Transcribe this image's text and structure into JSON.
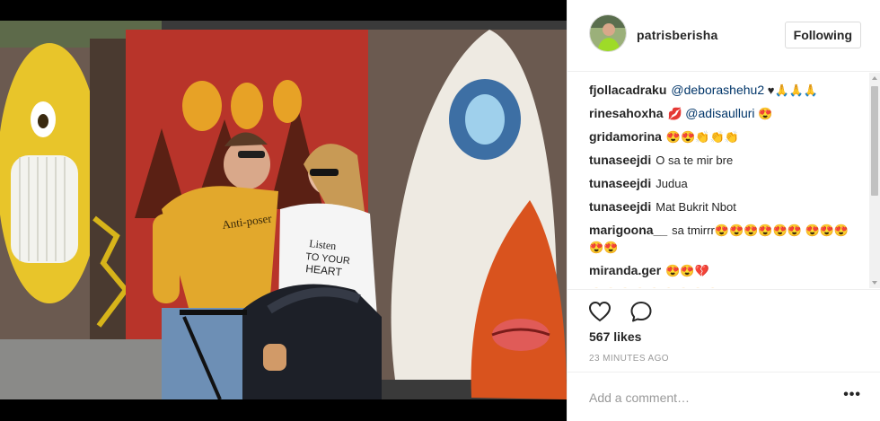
{
  "post": {
    "username": "patrisberisha",
    "follow_label": "Following",
    "photo_text": {
      "shirt_left": "Anti-poser",
      "shirt_right_line1": "Listen",
      "shirt_right_line2": "TO YOUR",
      "shirt_right_line3": "HEART"
    }
  },
  "comments": [
    {
      "user": "fjollacadraku",
      "mention": "@deborashehu2",
      "text": " ♥🙏🙏🙏"
    },
    {
      "user": "rinesahoxha",
      "pre": "💋 ",
      "mention": "@adisaulluri",
      "text": " 😍"
    },
    {
      "user": "gridamorina",
      "text": "😍😍👏👏👏"
    },
    {
      "user": "tunaseejdi",
      "text": "O sa te mir bre"
    },
    {
      "user": "tunaseejdi",
      "text": "Judua"
    },
    {
      "user": "tunaseejdi",
      "text": "Mat Bukrit Nbot"
    },
    {
      "user": "marigoona__",
      "text": "sa tmirrr😍😍😍😍😍😍 😍😍😍😍😍"
    },
    {
      "user": "miranda.ger",
      "text": "😍😍💔"
    },
    {
      "user": "",
      "text": "😍😍😍😍😍😍😍😍😍"
    }
  ],
  "actions": {
    "like_icon": "heart-icon",
    "comment_icon": "speech-bubble-icon",
    "likes": "567 likes",
    "timestamp": "23 MINUTES AGO"
  },
  "add_comment": {
    "placeholder": "Add a comment…",
    "more_label": "•••"
  }
}
